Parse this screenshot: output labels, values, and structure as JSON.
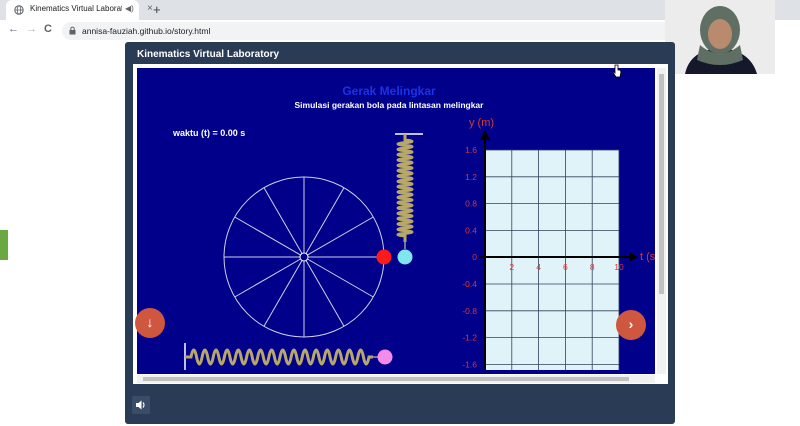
{
  "browser": {
    "tab_title": "Kinematics Virtual Laborator",
    "tab_close": "×",
    "new_tab": "+",
    "url": "annisa-fauziah.github.io/story.html",
    "back": "←",
    "forward": "→",
    "reload": "C"
  },
  "modal": {
    "title": "Kinematics Virtual Laboratory"
  },
  "simulation": {
    "heading": "Gerak Melingkar",
    "subtitle": "Simulasi gerakan bola pada lintasan melingkar",
    "time_label": "waktu (t) = 0.00 s",
    "y_axis_label": "y (m)",
    "t_axis_label": "t (s",
    "y_ticks": [
      "1.6",
      "1.2",
      "0.8",
      "0.4",
      "0",
      "-0.4",
      "-0.8",
      "-1.2",
      "-1.6"
    ],
    "t_ticks": [
      "2",
      "4",
      "6",
      "8",
      "10"
    ],
    "colors": {
      "background": "#00008b",
      "ball_red": "#ff1a1a",
      "ball_cyan": "#7fe6f0",
      "ball_pink": "#f58be8",
      "grid_fill": "#dff3f8",
      "tick_color": "#d93838",
      "heading_color": "#1a33e6"
    }
  },
  "buttons": {
    "down": "↓",
    "next": "›"
  },
  "icons": {
    "sound": "speaker-icon",
    "down": "arrow-down-icon",
    "next": "chevron-right-icon"
  }
}
